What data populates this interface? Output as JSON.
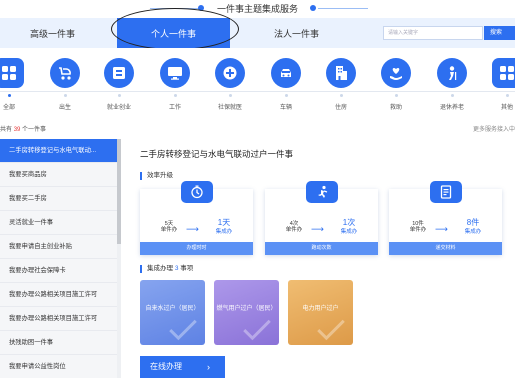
{
  "header": {
    "title": "一件事主题集成服务"
  },
  "tabs": [
    {
      "label": "高级一件事",
      "active": false
    },
    {
      "label": "个人一件事",
      "active": true
    },
    {
      "label": "法人一件事",
      "active": false
    }
  ],
  "search": {
    "placeholder": "请输入关键字",
    "button": "搜索"
  },
  "categories": [
    {
      "label": "全部",
      "icon": "grid-icon",
      "color": "#2d6ff0"
    },
    {
      "label": "出生",
      "icon": "stroller-icon",
      "color": "#2d6ff0"
    },
    {
      "label": "就业创业",
      "icon": "briefcase-icon",
      "color": "#2d6ff0"
    },
    {
      "label": "工作",
      "icon": "monitor-icon",
      "color": "#2d6ff0"
    },
    {
      "label": "社保就医",
      "icon": "medical-cross-icon",
      "color": "#2d6ff0"
    },
    {
      "label": "车辆",
      "icon": "car-icon",
      "color": "#2d6ff0"
    },
    {
      "label": "住房",
      "icon": "building-icon",
      "color": "#2d6ff0"
    },
    {
      "label": "救助",
      "icon": "heart-hand-icon",
      "color": "#2d6ff0"
    },
    {
      "label": "退休养老",
      "icon": "elder-icon",
      "color": "#2d6ff0"
    },
    {
      "label": "其他",
      "icon": "more-grid-icon",
      "color": "#2d6ff0"
    }
  ],
  "summary": {
    "prefix": "共有",
    "count": "39",
    "suffix": "个一件事",
    "more": "更多服务接入中"
  },
  "list": [
    {
      "label": "二手房转移登记与水电气联动...",
      "active": true
    },
    {
      "label": "我要买商品房",
      "active": false
    },
    {
      "label": "我要买二手房",
      "active": false
    },
    {
      "label": "灵活就业一件事",
      "active": false
    },
    {
      "label": "我要申请自主创业补贴",
      "active": false
    },
    {
      "label": "我要办理社会保障卡",
      "active": false
    },
    {
      "label": "我要办理公路相关项目施工许可",
      "active": false
    },
    {
      "label": "我要办理公路相关项目施工许可",
      "active": false
    },
    {
      "label": "扶残助困一件事",
      "active": false
    },
    {
      "label": "我要申请公益性岗位",
      "active": false
    }
  ],
  "main": {
    "title": "二手房转移登记与水电气联动过户一件事",
    "efficiency_label": "效率升级",
    "cards": [
      {
        "icon": "clock-icon",
        "before_value": "5天",
        "before_label": "单件办",
        "after_value": "1天",
        "after_label": "集成办",
        "footer": "办理时时"
      },
      {
        "icon": "runner-icon",
        "before_value": "4次",
        "before_label": "单件办",
        "after_value": "1次",
        "after_label": "集成办",
        "footer": "跑动次数"
      },
      {
        "icon": "document-icon",
        "before_value": "10件",
        "before_label": "单件办",
        "after_value": "8件",
        "after_label": "集成办",
        "footer": "递交材料"
      }
    ],
    "integrated": {
      "prefix": "集成办理",
      "count": "3",
      "suffix": "事项"
    },
    "tiles": [
      {
        "label": "自来水过户（居民）",
        "color": "#6d8ee8"
      },
      {
        "label": "燃气用户过户（居民）",
        "color": "#9a84e0"
      },
      {
        "label": "电力用户过户",
        "color": "#e4a85a"
      }
    ],
    "online_button": "在线办理"
  }
}
